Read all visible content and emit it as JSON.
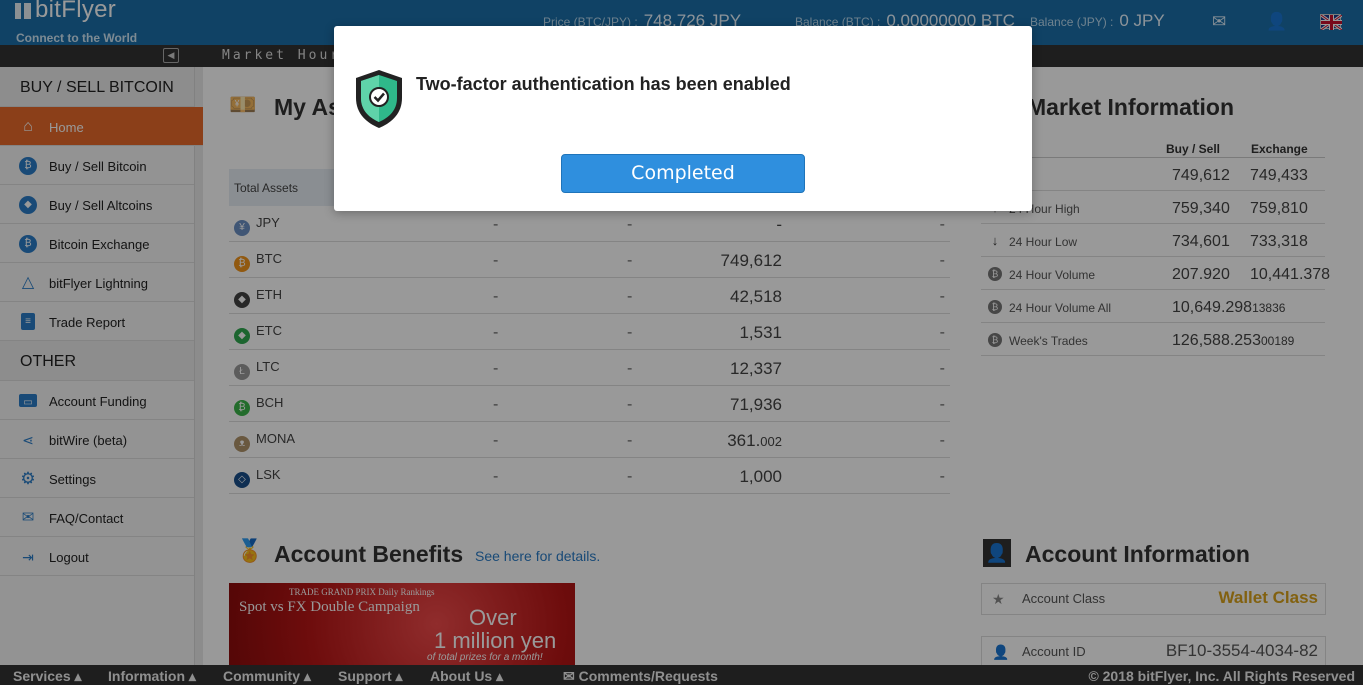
{
  "header": {
    "logo": "bitFlyer",
    "tagline": "Connect to the World",
    "price_label": "Price (BTC/JPY) :",
    "price_value": "748,726 JPY",
    "balance_btc_label": "Balance (BTC) :",
    "balance_btc_value": "0.00000000 BTC",
    "balance_jpy_label": "Balance (JPY) :",
    "balance_jpy_value": "0 JPY",
    "icons": [
      "mail-icon",
      "user-icon",
      "uk-flag-icon"
    ]
  },
  "ticker": {
    "text": "Market Hour"
  },
  "sidebar": {
    "section1": "BUY / SELL BITCOIN",
    "section2": "OTHER",
    "items": [
      {
        "label": "Home",
        "icon": "home-icon"
      },
      {
        "label": "Buy / Sell Bitcoin",
        "icon": "bitcoin-icon"
      },
      {
        "label": "Buy / Sell Altcoins",
        "icon": "ethereum-icon"
      },
      {
        "label": "Bitcoin Exchange",
        "icon": "bitcoin-icon"
      },
      {
        "label": "bitFlyer Lightning",
        "icon": "lightning-icon"
      },
      {
        "label": "Trade Report",
        "icon": "report-icon"
      },
      {
        "label": "Account Funding",
        "icon": "funding-icon"
      },
      {
        "label": "bitWire (beta)",
        "icon": "share-icon"
      },
      {
        "label": "Settings",
        "icon": "gear-icon"
      },
      {
        "label": "FAQ/Contact",
        "icon": "mail-icon"
      },
      {
        "label": "Logout",
        "icon": "logout-icon"
      }
    ]
  },
  "assets": {
    "title": "My As",
    "header": "Total Assets",
    "rows": [
      {
        "name": "JPY",
        "c1": "-",
        "c2": "-",
        "c3": "-",
        "c4": "-",
        "color": "#6b8fc4",
        "glyph": "¥"
      },
      {
        "name": "BTC",
        "c1": "-",
        "c2": "-",
        "c3": "749,612",
        "c4": "-",
        "color": "#f2941c",
        "glyph": "₿"
      },
      {
        "name": "ETH",
        "c1": "-",
        "c2": "-",
        "c3": "42,518",
        "c4": "-",
        "color": "#444",
        "glyph": "◆"
      },
      {
        "name": "ETC",
        "c1": "-",
        "c2": "-",
        "c3": "1,531",
        "c4": "-",
        "color": "#2fa84f",
        "glyph": "◆"
      },
      {
        "name": "LTC",
        "c1": "-",
        "c2": "-",
        "c3": "12,337",
        "c4": "-",
        "color": "#999",
        "glyph": "Ł"
      },
      {
        "name": "BCH",
        "c1": "-",
        "c2": "-",
        "c3": "71,936",
        "c4": "-",
        "color": "#3bb54a",
        "glyph": "₿"
      },
      {
        "name": "MONA",
        "c1": "-",
        "c2": "-",
        "c3": "361.",
        "c3s": "002",
        "c4": "-",
        "color": "#b0936a",
        "glyph": "ᴥ"
      },
      {
        "name": "LSK",
        "c1": "-",
        "c2": "-",
        "c3": "1,000",
        "c4": "-",
        "color": "#1a4f8a",
        "glyph": "◇"
      }
    ]
  },
  "market": {
    "title": "Market Information",
    "col_buy": "Buy / Sell",
    "col_ex": "Exchange",
    "rows": [
      {
        "label": "e",
        "buy": "749,612",
        "ex": "749,433"
      },
      {
        "label": "24 Hour High",
        "buy": "759,340",
        "ex": "759,810"
      },
      {
        "label": "24 Hour Low",
        "buy": "734,601",
        "ex": "733,318"
      },
      {
        "label": "24 Hour Volume",
        "buy": "207.920",
        "ex": "10,441.378"
      },
      {
        "label": "24 Hour Volume All",
        "buy": "10,649.298",
        "buy_s": "13836",
        "ex": ""
      },
      {
        "label": "Week's Trades",
        "buy": "126,588.253",
        "buy_s": "00189",
        "ex": ""
      }
    ]
  },
  "benefits": {
    "title": "Account Benefits",
    "link": "See here for details.",
    "banner": {
      "line1": "TRADE GRAND PRIX Daily Rankings",
      "line2": "Spot vs FX Double Campaign",
      "line3": "Over",
      "line4": "1 million yen",
      "line5": "of total prizes for a month!"
    }
  },
  "account": {
    "title": "Account Information",
    "class_label": "Account Class",
    "class_value": "Wallet Class",
    "id_label": "Account ID",
    "id_value": "BF10-3554-4034-82"
  },
  "footer": {
    "links": [
      "Services ▴",
      "Information ▴",
      "Community ▴",
      "Support ▴",
      "About Us ▴"
    ],
    "comments": "Comments/Requests",
    "copyright": "© 2018 bitFlyer, Inc. All Rights Reserved"
  },
  "dialog": {
    "message": "Two-factor authentication has been enabled",
    "button": "Completed"
  }
}
